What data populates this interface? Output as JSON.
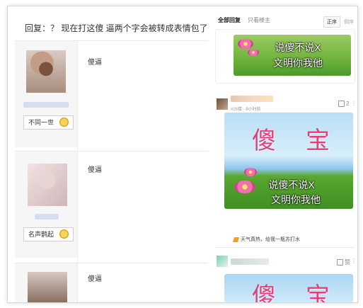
{
  "thread": {
    "title": "回复：？ 现在打这傻 逼两个字会被转成表情包了？"
  },
  "posts_left": [
    {
      "badge": "不同一世",
      "reply": "傻逼"
    },
    {
      "badge": "名声鹊起",
      "reply": "傻逼"
    },
    {
      "badge": "",
      "reply": "傻逼"
    }
  ],
  "right": {
    "tabs": [
      {
        "label": "全部回复"
      },
      {
        "label": "只看楼主"
      }
    ],
    "sort": {
      "asc": "正序",
      "desc": "倒序"
    },
    "meme": {
      "big_text": "傻宝",
      "line1": "说傻不说X",
      "line2": "文明你我他"
    },
    "post1": {
      "meta": "#26楼 · 8小时前",
      "likes": "2",
      "more": "⋮",
      "comment": "天气真热，给我一瓶苏打水"
    },
    "post2": {
      "likes": "赞",
      "more": "⋮"
    }
  },
  "icons": [
    "medal-icon",
    "thumb-up-icon",
    "more-icon",
    "lightning-icon"
  ]
}
